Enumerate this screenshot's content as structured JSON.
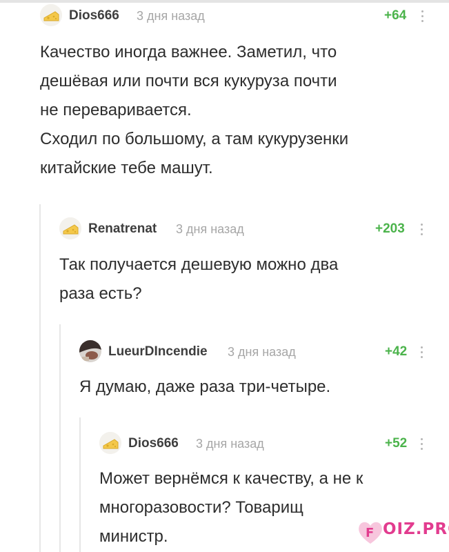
{
  "comments": [
    {
      "author": "Dios666",
      "time": "3 дня назад",
      "rating": "+64",
      "lines": [
        "Качество иногда важнее. Заметил, что",
        "дешёвая или почти вся кукуруза почти",
        "не переваривается.",
        "Сходил по большому, а там кукурузенки",
        "китайские тебе машут."
      ]
    },
    {
      "author": "Renatrenat",
      "time": "3 дня назад",
      "rating": "+203",
      "lines": [
        "Так получается дешевую можно два",
        "раза есть?"
      ]
    },
    {
      "author": "LueurDIncendie",
      "time": "3 дня назад",
      "rating": "+42",
      "lines": [
        "Я думаю, даже раза три-четыре."
      ]
    },
    {
      "author": "Dios666",
      "time": "3 дня назад",
      "rating": "+52",
      "lines": [
        "Может вернёмся к качеству, а не к",
        "многоразовости? Товарищ",
        "министр."
      ]
    }
  ],
  "watermark": {
    "text": "OIZ.PRO",
    "icon": "heart-f-logo-icon"
  },
  "colors": {
    "rating": "#4bb34b",
    "author": "#3e3e3e",
    "time": "#a6a6a6",
    "watermark": "#e23c8f"
  }
}
